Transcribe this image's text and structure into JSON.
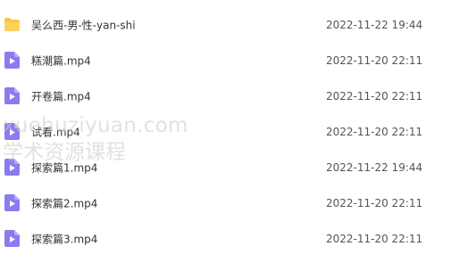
{
  "files": [
    {
      "name": "吴么西-男-性-yan-shi",
      "date": "2022-11-22 19:44",
      "type": "folder",
      "icon": "folder-icon"
    },
    {
      "name": "糕潮篇.mp4",
      "date": "2022-11-20 22:11",
      "type": "video",
      "icon": "video-file-icon"
    },
    {
      "name": "开卷篇.mp4",
      "date": "2022-11-20 22:11",
      "type": "video",
      "icon": "video-file-icon"
    },
    {
      "name": "试看.mp4",
      "date": "2022-11-20 22:11",
      "type": "video",
      "icon": "video-file-icon"
    },
    {
      "name": "探索篇1.mp4",
      "date": "2022-11-22 19:44",
      "type": "video",
      "icon": "video-file-icon"
    },
    {
      "name": "探索篇2.mp4",
      "date": "2022-11-20 22:11",
      "type": "video",
      "icon": "video-file-icon"
    },
    {
      "name": "探索篇3.mp4",
      "date": "2022-11-20 22:11",
      "type": "video",
      "icon": "video-file-icon"
    }
  ],
  "watermark": {
    "line1": "xuehuziyuan.com",
    "line2": "学术资源课程"
  },
  "colors": {
    "folder": "#f7c948",
    "video": "#8a7cf0",
    "watermark": "#c8c8c8"
  }
}
